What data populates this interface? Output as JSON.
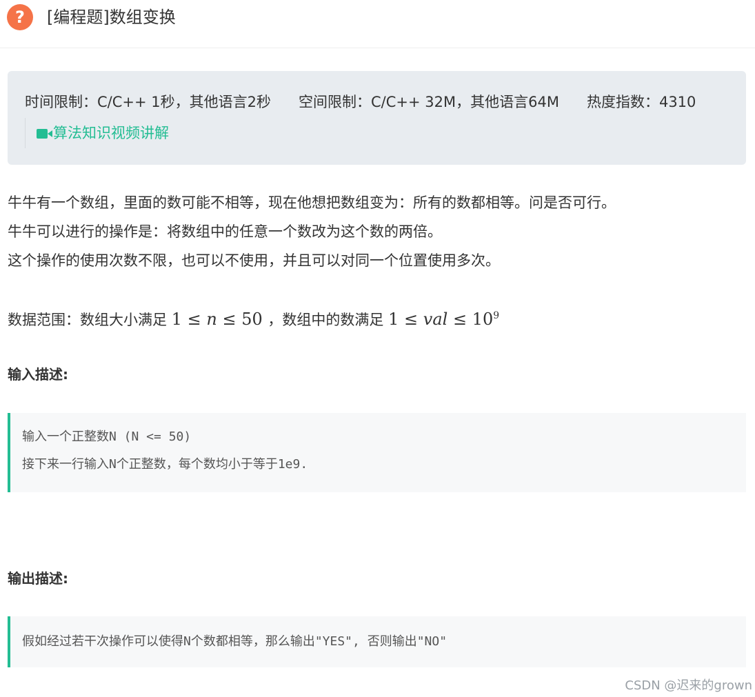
{
  "header": {
    "icon": "question-circle-icon",
    "icon_glyph": "?",
    "title": "[编程题]数组变换",
    "accent_color": "#f57348"
  },
  "limits": {
    "time": "时间限制：C/C++ 1秒，其他语言2秒",
    "space": "空间限制：C/C++ 32M，其他语言64M",
    "heat": "热度指数：4310"
  },
  "video": {
    "icon": "video-camera-icon",
    "label": "算法知识视频讲解",
    "color": "#23bd93"
  },
  "description": {
    "lines": [
      "牛牛有一个数组，里面的数可能不相等，现在他想把数组变为：所有的数都相等。问是否可行。",
      "牛牛可以进行的操作是：将数组中的任意一个数改为这个数的两倍。",
      "这个操作的使用次数不限，也可以不使用，并且可以对同一个位置使用多次。"
    ],
    "range_prefix": "数据范围：数组大小满足",
    "range_n": {
      "low": "1",
      "var": "n",
      "high": "50"
    },
    "range_mid": "，数组中的数满足",
    "range_val": {
      "low": "1",
      "var": "val",
      "base": "10",
      "exp": "9"
    },
    "leq": "≤"
  },
  "input_section": {
    "title": "输入描述:",
    "lines": [
      "输入一个正整数N (N <= 50)",
      "接下来一行输入N个正整数，每个数均小于等于1e9."
    ]
  },
  "output_section": {
    "title": "输出描述:",
    "lines": [
      "假如经过若干次操作可以使得N个数都相等，那么输出\"YES\", 否则输出\"NO\""
    ]
  },
  "watermark": "CSDN @迟来的grown"
}
